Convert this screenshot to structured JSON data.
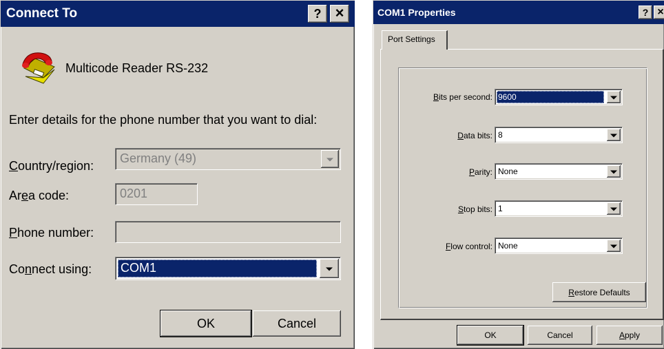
{
  "connect": {
    "title": "Connect To",
    "help": "?",
    "close": "×",
    "device_name": "Multicode Reader RS-232",
    "instruction": "Enter details for the phone number that you want to dial:",
    "country_label_u": "C",
    "country_label_rest": "ountry/region:",
    "country_value": "Germany (49)",
    "area_label_pre": "Ar",
    "area_label_u": "e",
    "area_label_post": "a code:",
    "area_value": "0201",
    "phone_label_u": "P",
    "phone_label_rest": "hone number:",
    "phone_value": "",
    "connect_label_pre": "Co",
    "connect_label_u": "n",
    "connect_label_post": "nect using:",
    "connect_value": "COM1",
    "ok": "OK",
    "cancel": "Cancel"
  },
  "com": {
    "title": "COM1 Properties",
    "help": "?",
    "close": "×",
    "tab": "Port Settings",
    "bits_u": "B",
    "bits_rest": "its per second:",
    "bits_value": "9600",
    "data_u": "D",
    "data_rest": "ata bits:",
    "data_value": "8",
    "parity_u": "P",
    "parity_rest": "arity:",
    "parity_value": "None",
    "stop_u": "S",
    "stop_rest": "top bits:",
    "stop_value": "1",
    "flow_u": "F",
    "flow_rest": "low control:",
    "flow_value": "None",
    "restore_u": "R",
    "restore_rest": "estore Defaults",
    "ok": "OK",
    "cancel": "Cancel",
    "apply_u": "A",
    "apply_rest": "pply"
  },
  "colors": {
    "titlebar": "#0a246a",
    "face": "#d4d0c8",
    "selection": "#0a246a"
  }
}
